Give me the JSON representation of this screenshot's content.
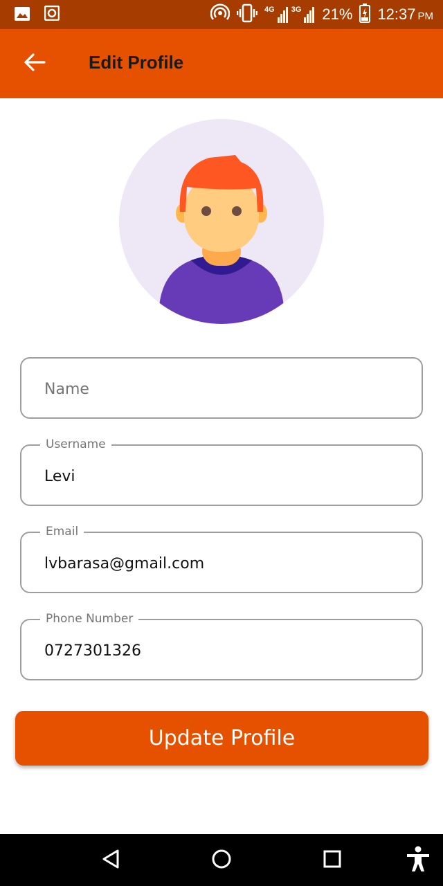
{
  "status_bar": {
    "network_4g": "4G",
    "network_3g": "3G",
    "battery": "21%",
    "time": "12:37",
    "ampm": "PM",
    "icons": [
      "gallery-icon",
      "screenshot-icon",
      "hotspot-icon",
      "vibrate-icon",
      "signal-icon",
      "battery-charging-icon"
    ]
  },
  "app_bar": {
    "title": "Edit Profile",
    "back_icon": "arrow-back-icon"
  },
  "form": {
    "name": {
      "placeholder": "Name",
      "value": ""
    },
    "username": {
      "label": "Username",
      "value": "Levi"
    },
    "email": {
      "label": "Email",
      "value": "lvbarasa@gmail.com"
    },
    "phone": {
      "label": "Phone Number",
      "value": "0727301326"
    }
  },
  "update_button": {
    "label": "Update Profile"
  },
  "nav_bar": {
    "icons": [
      "back-triangle-icon",
      "home-circle-icon",
      "recents-square-icon",
      "accessibility-icon"
    ]
  },
  "colors": {
    "status_bar": "#a63c00",
    "app_bar": "#e65100",
    "button": "#e65100",
    "avatar_bg": "#ede7f6"
  }
}
